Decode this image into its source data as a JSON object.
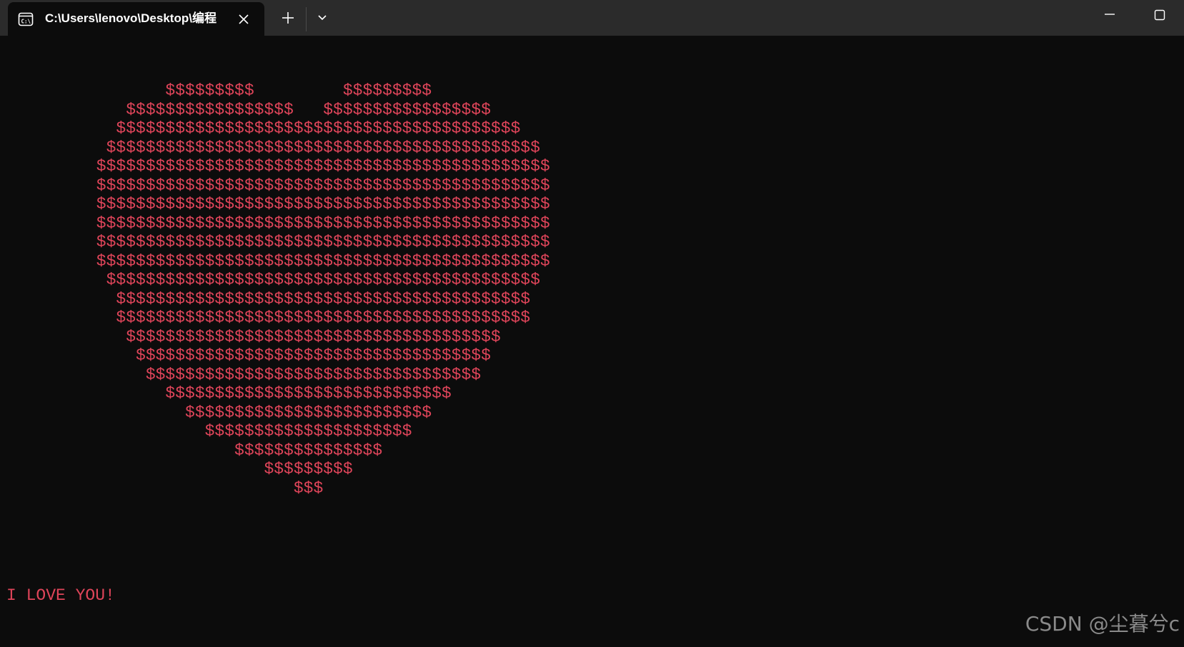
{
  "titlebar": {
    "tab": {
      "icon": "terminal-icon",
      "title": "C:\\Users\\lenovo\\Desktop\\编程"
    },
    "new_tab_icon": "plus-icon",
    "dropdown_icon": "chevron-down-icon",
    "window_controls": [
      "minimize-icon",
      "maximize-icon"
    ]
  },
  "terminal": {
    "text_color": "#e0455a",
    "background": "#0c0c0c",
    "heart_lines": [
      "        $$$$$$$$$         $$$$$$$$$",
      "    $$$$$$$$$$$$$$$$$   $$$$$$$$$$$$$$$$$",
      "   $$$$$$$$$$$$$$$$$$$$$$$$$$$$$$$$$$$$$$$$$",
      "  $$$$$$$$$$$$$$$$$$$$$$$$$$$$$$$$$$$$$$$$$$$$",
      " $$$$$$$$$$$$$$$$$$$$$$$$$$$$$$$$$$$$$$$$$$$$$$",
      " $$$$$$$$$$$$$$$$$$$$$$$$$$$$$$$$$$$$$$$$$$$$$$",
      " $$$$$$$$$$$$$$$$$$$$$$$$$$$$$$$$$$$$$$$$$$$$$$",
      " $$$$$$$$$$$$$$$$$$$$$$$$$$$$$$$$$$$$$$$$$$$$$$",
      " $$$$$$$$$$$$$$$$$$$$$$$$$$$$$$$$$$$$$$$$$$$$$$",
      " $$$$$$$$$$$$$$$$$$$$$$$$$$$$$$$$$$$$$$$$$$$$$$",
      "  $$$$$$$$$$$$$$$$$$$$$$$$$$$$$$$$$$$$$$$$$$$$",
      "   $$$$$$$$$$$$$$$$$$$$$$$$$$$$$$$$$$$$$$$$$$",
      "   $$$$$$$$$$$$$$$$$$$$$$$$$$$$$$$$$$$$$$$$$$",
      "    $$$$$$$$$$$$$$$$$$$$$$$$$$$$$$$$$$$$$$",
      "     $$$$$$$$$$$$$$$$$$$$$$$$$$$$$$$$$$$$",
      "      $$$$$$$$$$$$$$$$$$$$$$$$$$$$$$$$$$",
      "        $$$$$$$$$$$$$$$$$$$$$$$$$$$$$",
      "          $$$$$$$$$$$$$$$$$$$$$$$$$",
      "            $$$$$$$$$$$$$$$$$$$$$",
      "               $$$$$$$$$$$$$$$",
      "                  $$$$$$$$$",
      "                     $$$"
    ],
    "message": "I LOVE YOU!"
  },
  "watermark": "CSDN @尘暮兮c"
}
